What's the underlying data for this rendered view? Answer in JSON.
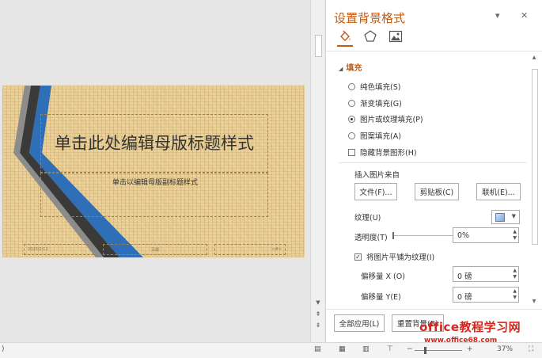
{
  "slide": {
    "title": "单击此处编辑母版标题样式",
    "subtitle": "单击以编辑母版副标题样式",
    "footer_date": "2020/2/11",
    "footer_text": "页脚",
    "footer_num": "<#>"
  },
  "pane": {
    "title": "设置背景格式",
    "tabs": [
      "填充",
      "效果",
      "图片"
    ],
    "section": "填充",
    "fill_options": [
      {
        "label": "纯色填充(S)",
        "selected": false
      },
      {
        "label": "渐变填充(G)",
        "selected": false
      },
      {
        "label": "图片或纹理填充(P)",
        "selected": true
      },
      {
        "label": "图案填充(A)",
        "selected": false
      }
    ],
    "hide_bg_graphics": "隐藏背景图形(H)",
    "insert_from": "插入图片来自",
    "btn_file": "文件(F)...",
    "btn_clipboard": "剪贴板(C)",
    "btn_online": "联机(E)...",
    "texture_label": "纹理(U)",
    "transparency_label": "透明度(T)",
    "transparency_value": "0%",
    "transparency_level": 0,
    "tile_label": "将图片平铺为纹理(I)",
    "tile_checked": true,
    "offset_x_label": "偏移量 X (O)",
    "offset_x_value": "0 磅",
    "offset_y_label": "偏移量 Y(E)",
    "offset_y_value": "0 磅",
    "btn_apply_all": "全部应用(L)",
    "btn_reset": "重置背景(B)"
  },
  "status": {
    "left": ")",
    "zoom": "37%"
  },
  "watermark": {
    "line1": "office教程学习网",
    "line2": "www.office68.com"
  },
  "colors": {
    "accent": "#c55a11",
    "slide_bg": "#e9cf95",
    "stripe_blue": "#2e6fb7",
    "stripe_dark": "#3a3a3a",
    "watermark": "#d3271c"
  }
}
